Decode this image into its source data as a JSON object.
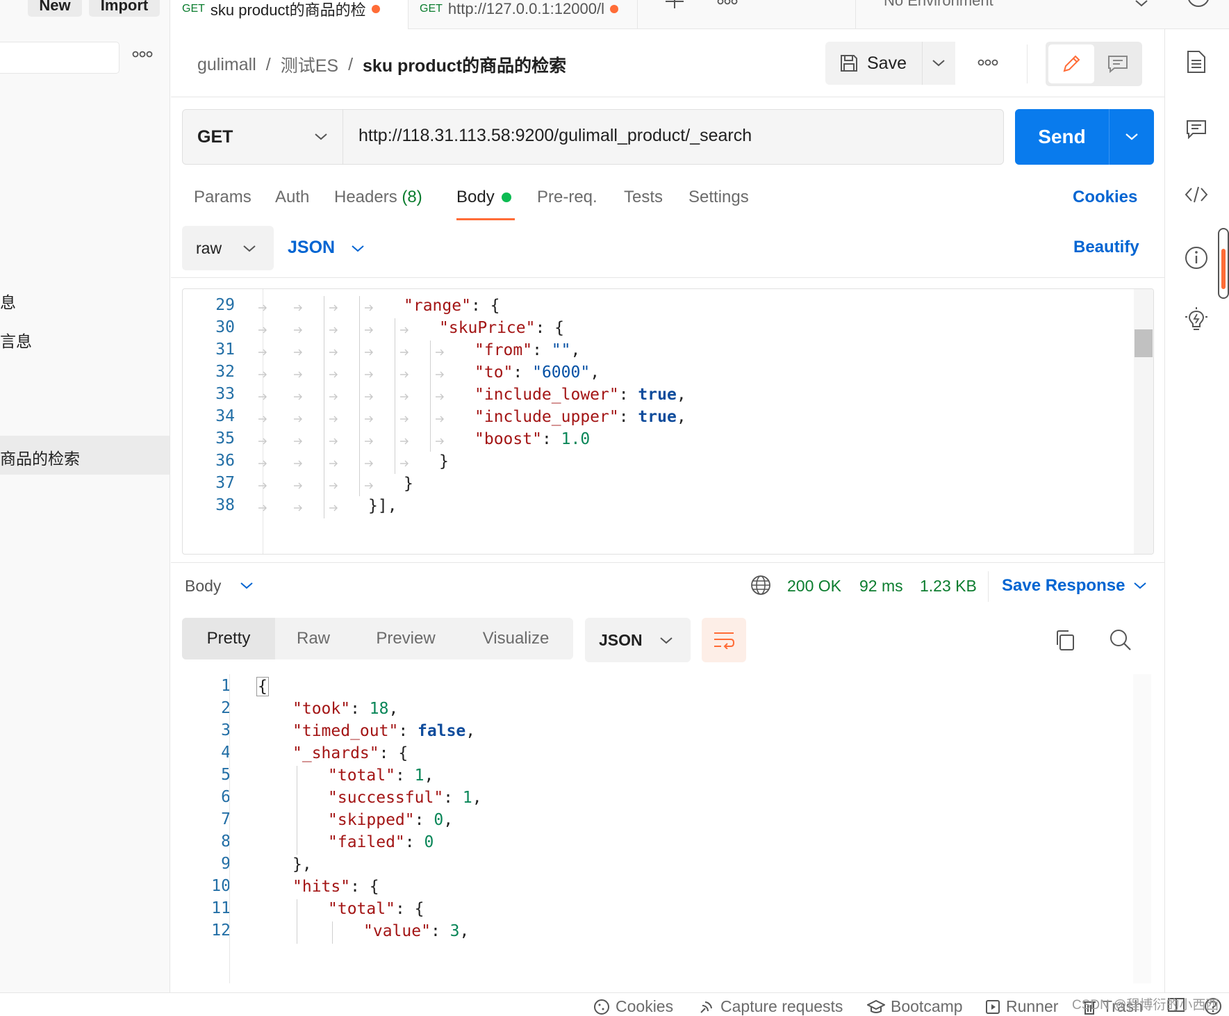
{
  "sidebar": {
    "new_label": "New",
    "import_label": "Import",
    "more_icon": "ooo",
    "item_partial_1": "息",
    "item_partial_2": "言息",
    "item_selected": "商品的检索"
  },
  "tabs": [
    {
      "method": "GET",
      "title": "sku product的商品的检"
    },
    {
      "method": "GET",
      "title": "http://127.0.0.1:12000/l"
    }
  ],
  "environment": "No Environment",
  "breadcrumb": {
    "collection": "gulimall",
    "folder": "测试ES",
    "request": "sku product的商品的检索",
    "sep": "/"
  },
  "header": {
    "save_label": "Save"
  },
  "request": {
    "method": "GET",
    "url": "http://118.31.113.58:9200/gulimall_product/_search",
    "send_label": "Send"
  },
  "request_tabs": {
    "params": "Params",
    "auth": "Auth",
    "headers": "Headers",
    "headers_count": "(8)",
    "body": "Body",
    "prereq": "Pre-req.",
    "tests": "Tests",
    "settings": "Settings",
    "cookies": "Cookies"
  },
  "body_options": {
    "mode": "raw",
    "language": "JSON",
    "beautify": "Beautify"
  },
  "request_body_lines": [
    {
      "n": "29",
      "text": "\"range\": {"
    },
    {
      "n": "30",
      "text": "\"skuPrice\": {"
    },
    {
      "n": "31",
      "text": "\"from\": \"\","
    },
    {
      "n": "32",
      "text": "\"to\": \"6000\","
    },
    {
      "n": "33",
      "text": "\"include_lower\": true,"
    },
    {
      "n": "34",
      "text": "\"include_upper\": true,"
    },
    {
      "n": "35",
      "text": "\"boost\": 1.0"
    },
    {
      "n": "36",
      "text": "}"
    },
    {
      "n": "37",
      "text": "}"
    },
    {
      "n": "38",
      "text": "}],"
    }
  ],
  "response": {
    "label": "Body",
    "status": "200 OK",
    "time": "92 ms",
    "size": "1.23 KB",
    "save_response": "Save Response",
    "tabs": {
      "pretty": "Pretty",
      "raw": "Raw",
      "preview": "Preview",
      "visualize": "Visualize"
    },
    "format": "JSON"
  },
  "response_lines": [
    {
      "n": "1",
      "text": "{"
    },
    {
      "n": "2",
      "text": "\"took\": 18,"
    },
    {
      "n": "3",
      "text": "\"timed_out\": false,"
    },
    {
      "n": "4",
      "text": "\"_shards\": {"
    },
    {
      "n": "5",
      "text": "\"total\": 1,"
    },
    {
      "n": "6",
      "text": "\"successful\": 1,"
    },
    {
      "n": "7",
      "text": "\"skipped\": 0,"
    },
    {
      "n": "8",
      "text": "\"failed\": 0"
    },
    {
      "n": "9",
      "text": "},"
    },
    {
      "n": "10",
      "text": "\"hits\": {"
    },
    {
      "n": "11",
      "text": "\"total\": {"
    },
    {
      "n": "12",
      "text": "\"value\": 3,"
    }
  ],
  "statusbar": {
    "cookies": "Cookies",
    "capture": "Capture requests",
    "bootcamp": "Bootcamp",
    "runner": "Runner",
    "trash": "Trash"
  },
  "watermark": "CSDN @程博衍的小西西",
  "colors": {
    "accent": "#097bed",
    "active_tab": "#ff6c37",
    "link": "#0265d2",
    "ok": "#0c7d2f"
  }
}
